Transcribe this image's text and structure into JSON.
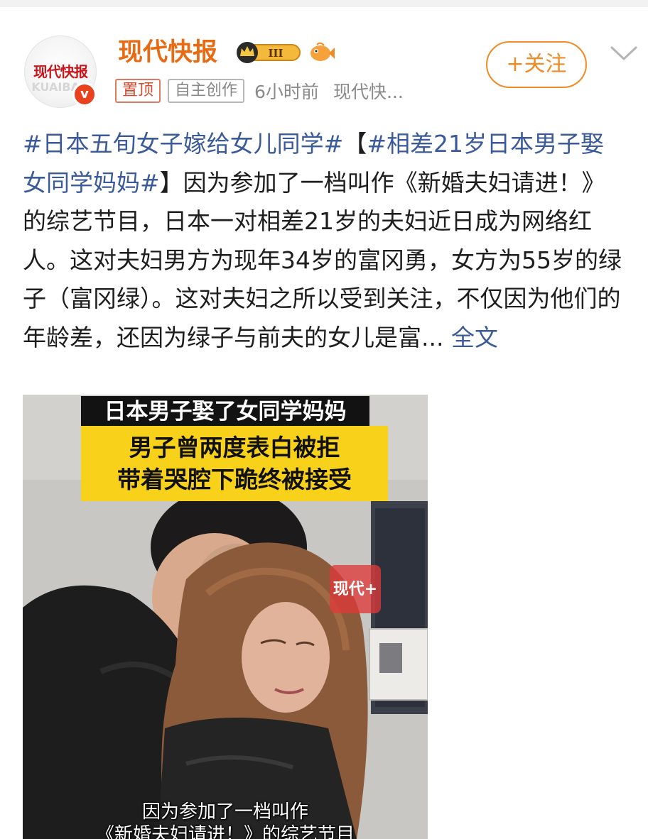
{
  "header": {
    "account_name": "现代快报",
    "avatar_logo_text": "现代快报",
    "verify_badge_letter": "v",
    "level_badge_text": "III",
    "pin_tag": "置顶",
    "original_tag": "自主创作",
    "time": "6小时前",
    "source": "现代快...",
    "follow_label": "+关注"
  },
  "post": {
    "hashtag1": "#日本五旬女子嫁给女儿同学#",
    "bracket_open": "【",
    "hashtag2": "#相差21岁日本男子娶女同学妈妈#",
    "body": "】因为参加了一档叫作《新婚夫妇请进！》的综艺节目，日本一对相差21岁的夫妇近日成为网络红人。这对夫妇男方为现年34岁的富冈勇，女方为55岁的绿子（富冈绿）。这对夫妇之所以受到关注，不仅因为他们的年龄差，还因为绿子与前夫的女儿是富...",
    "full_text_link": " 全文"
  },
  "video": {
    "banner_top": "日本男子娶了女同学妈妈",
    "banner_line1": "男子曾两度表白被拒",
    "banner_line2": "带着哭腔下跪终被接受",
    "watermark": "现代+",
    "subtitle_line1": "因为参加了一档叫作",
    "subtitle_line2": "《新婚夫妇请进！》的综艺节目"
  },
  "colors": {
    "account_name": "#e86b13",
    "follow_accent": "#f08a24",
    "hashtag": "#3b5a9a",
    "banner_yellow": "#f7d11a",
    "verify_red": "#e8421f"
  }
}
